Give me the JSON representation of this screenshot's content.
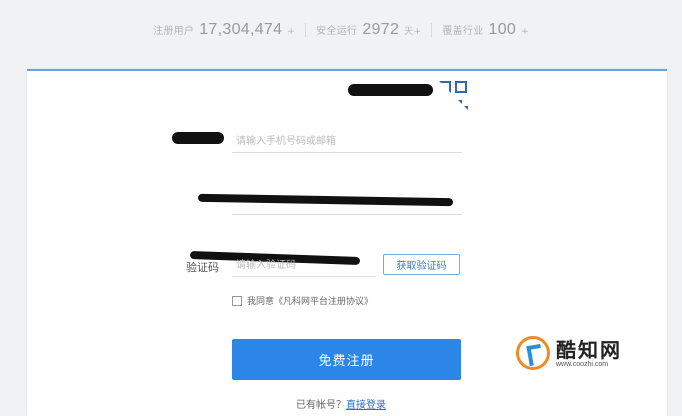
{
  "stats": [
    {
      "label": "注册用户",
      "value": "17,304,474",
      "suffix": "+"
    },
    {
      "label": "安全运行",
      "value": "2972",
      "suffix": "天+"
    },
    {
      "label": "覆盖行业",
      "value": "100",
      "suffix": "+"
    }
  ],
  "form": {
    "phone_placeholder": "请输入手机号码或邮箱",
    "code_label": "验证码",
    "code_placeholder": "请输入验证码",
    "get_code_label": "获取验证码",
    "agree_text": "我同意《凡科网平台注册协议》",
    "register_label": "免费注册"
  },
  "login": {
    "prompt": "已有帐号？",
    "link": "直接登录"
  },
  "watermark": {
    "name": "酷知网",
    "url": "www.coozhi.com"
  },
  "colors": {
    "accent": "#2b86e8",
    "card_top_border": "#6aa3dc"
  }
}
